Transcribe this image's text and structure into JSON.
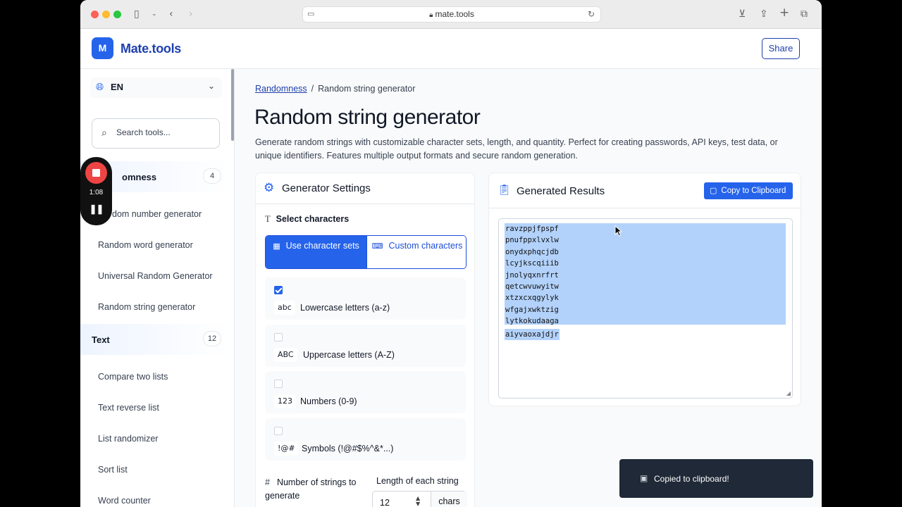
{
  "browser": {
    "url": "mate.tools"
  },
  "header": {
    "logo_letter": "M",
    "logo_text": "Mate.tools",
    "share_label": "Share"
  },
  "sidebar": {
    "language": "EN",
    "search_placeholder": "Search tools...",
    "categories": [
      {
        "label": "Randomness",
        "visible_label": "omness",
        "count": "4",
        "items": [
          "Random number generator",
          "Random word generator",
          "Universal Random Generator",
          "Random string generator"
        ],
        "visible_first_item": "dom number generator"
      },
      {
        "label": "Text",
        "count": "12",
        "items": [
          "Compare two lists",
          "Text reverse list",
          "List randomizer",
          "Sort list",
          "Word counter"
        ]
      }
    ]
  },
  "recording": {
    "time": "1:08",
    "pause_glyph": "❚❚"
  },
  "main": {
    "breadcrumb": {
      "parent": "Randomness",
      "separator": "/",
      "current": "Random string generator"
    },
    "title": "Random string generator",
    "description": "Generate random strings with customizable character sets, length, and quantity. Perfect for creating passwords, API keys, test data, or unique identifiers. Features multiple output formats and secure random generation."
  },
  "settings": {
    "title": "Generator Settings",
    "select_chars_label": "Select characters",
    "mode_buttons": {
      "charsets": "Use character sets",
      "custom": "Custom characters"
    },
    "options": [
      {
        "tag": "abc",
        "label": "Lowercase letters (a-z)",
        "checked": true
      },
      {
        "tag": "ABC",
        "label": "Uppercase letters (A-Z)",
        "checked": false
      },
      {
        "tag": "123",
        "label": "Numbers (0-9)",
        "checked": false
      },
      {
        "tag": "!@#",
        "label": "Symbols (!@#$%^&*...)",
        "checked": false
      }
    ],
    "count_label": "Number of strings to generate",
    "length_label": "Length of each string",
    "length_value": "12",
    "length_unit": "chars"
  },
  "results": {
    "title": "Generated Results",
    "copy_label": "Copy to Clipboard",
    "lines": [
      "ravzppjfpspf",
      "pnufppxlvxlw",
      "onydxphqcjdb",
      "lcyjkscqiiib",
      "jnolyqxnrfrt",
      "qetcwvuwyitw",
      "xtzxcxqgylyk",
      "wfgajxwktzig",
      "lytkokudaaga",
      "aiyvaoxajdjr"
    ]
  },
  "toast": {
    "message": "Copied to clipboard!"
  },
  "colors": {
    "accent": "#2563eb",
    "brand_text": "#1e40af",
    "selection": "#b3d2fb",
    "toast_bg": "#1f2937",
    "record": "#ef4444"
  }
}
